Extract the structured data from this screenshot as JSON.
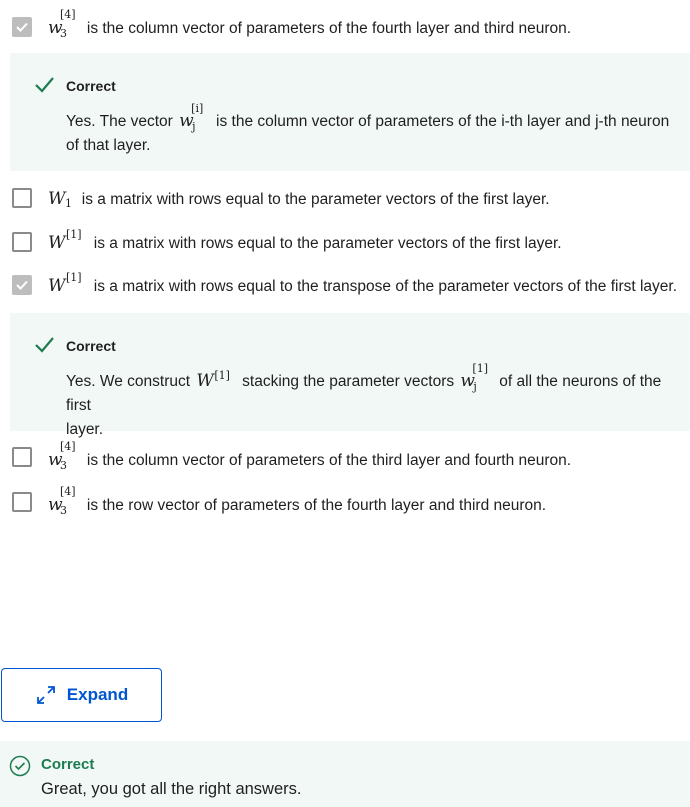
{
  "options": [
    {
      "id": "opt1",
      "checked": true,
      "symbol": "w",
      "sup": "[4]",
      "sub": "3",
      "text": "is the column vector of parameters of the fourth layer and third neuron."
    },
    {
      "id": "opt2",
      "checked": false,
      "symbol": "W",
      "sub": "1",
      "text": "is a matrix with rows equal to the parameter vectors of the first layer."
    },
    {
      "id": "opt3",
      "checked": false,
      "symbol": "W",
      "sup": "[1]",
      "text": "is a matrix with rows equal to the parameter vectors of the first layer."
    },
    {
      "id": "opt4",
      "checked": true,
      "symbol": "W",
      "sup": "[1]",
      "text": "is a matrix with rows equal to the transpose of the parameter vectors of the first layer."
    },
    {
      "id": "opt5",
      "checked": false,
      "symbol": "w",
      "sup": "[4]",
      "sub": "3",
      "text": "is the column vector of parameters of the third layer and fourth neuron."
    },
    {
      "id": "opt6",
      "checked": false,
      "symbol": "w",
      "sup": "[4]",
      "sub": "3",
      "text": "is the row vector of parameters of the fourth layer and third neuron."
    }
  ],
  "feedback1": {
    "title": "Correct",
    "pre": "Yes. The vector",
    "symbol": "w",
    "sup": "[i]",
    "sub": "j",
    "post": "is the column vector of parameters of the i-th layer and j-th neuron",
    "line2": "of that layer."
  },
  "feedback2": {
    "title": "Correct",
    "pre": "Yes. We construct",
    "symbol1": "W",
    "sup1": "[1]",
    "mid": "stacking the parameter vectors",
    "symbol2": "w",
    "sup2": "[1]",
    "sub2": "j",
    "post": "of all the neurons of the first",
    "line2": "layer."
  },
  "expand": {
    "label": "Expand"
  },
  "result": {
    "title": "Correct",
    "message": "Great, you got all the right answers."
  },
  "colors": {
    "accent": "#0056d2",
    "success": "#1d7c50",
    "feedback_bg": "#f2f8f5"
  }
}
